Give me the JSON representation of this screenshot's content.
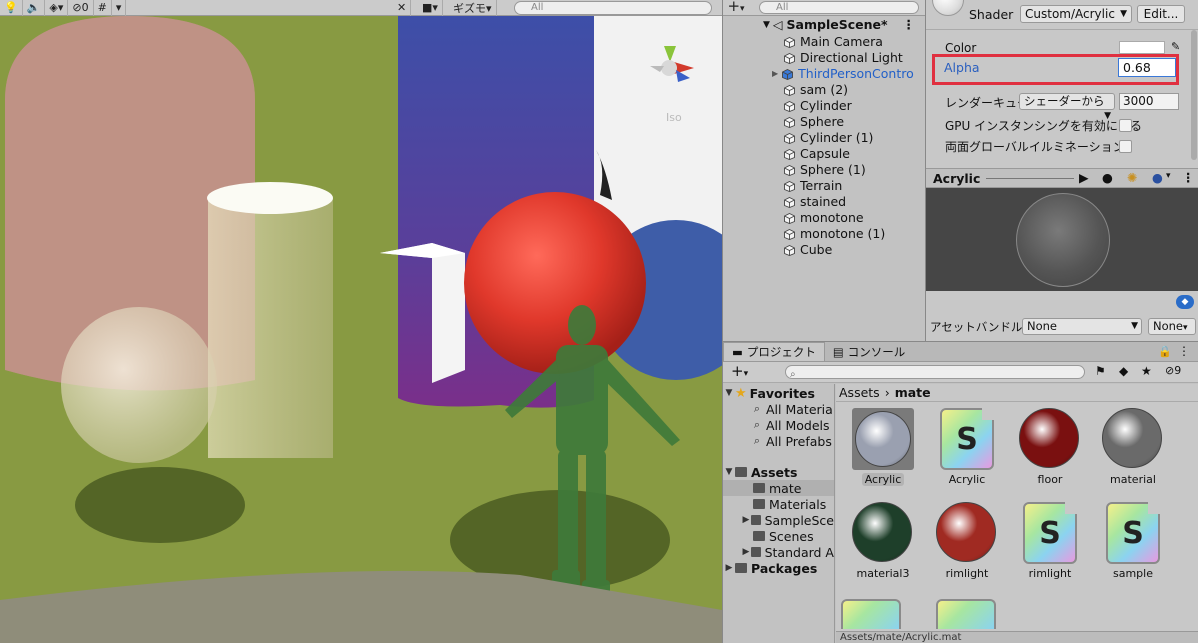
{
  "scene_view": {
    "toolbar": {
      "hidden_count": "0",
      "gizmo_label": "ギズモ",
      "search_placeholder": "All"
    },
    "iso_label": "Iso"
  },
  "hierarchy": {
    "search_placeholder": "All",
    "scene_name": "SampleScene*",
    "items": [
      {
        "label": "Main Camera"
      },
      {
        "label": "Directional Light"
      },
      {
        "label": "ThirdPersonContro"
      },
      {
        "label": "sam (2)"
      },
      {
        "label": "Cylinder"
      },
      {
        "label": "Sphere"
      },
      {
        "label": "Cylinder (1)"
      },
      {
        "label": "Capsule"
      },
      {
        "label": "Sphere (1)"
      },
      {
        "label": "Terrain"
      },
      {
        "label": "stained"
      },
      {
        "label": "monotone"
      },
      {
        "label": "monotone (1)"
      },
      {
        "label": "Cube"
      }
    ]
  },
  "inspector": {
    "shader_label": "Shader",
    "shader_value": "Custom/Acrylic",
    "edit_label": "Edit...",
    "color_label": "Color",
    "alpha_label": "Alpha",
    "alpha_value": "0.68",
    "render_queue_label": "レンダーキュー",
    "render_queue_mode": "シェーダーから",
    "render_queue_value": "3000",
    "gpu_instancing_label": "GPU インスタンシングを有効にする",
    "double_sided_gi_label": "両面グローバルイルミネーション",
    "preview_title": "Acrylic",
    "asset_bundle_label": "アセットバンドル",
    "asset_bundle_value": "None",
    "asset_variant_value": "None"
  },
  "project": {
    "tab_project": "プロジェクト",
    "tab_console": "コンソール",
    "hidden_count": "9",
    "tree": {
      "favorites_label": "Favorites",
      "favorites": [
        "All Materia",
        "All Models",
        "All Prefabs"
      ],
      "assets_label": "Assets",
      "assets": [
        "mate",
        "Materials",
        "SampleSce",
        "Scenes",
        "Standard A"
      ],
      "packages_label": "Packages"
    },
    "breadcrumb": {
      "root": "Assets",
      "current": "mate"
    },
    "items": [
      {
        "label": "Acrylic",
        "kind": "material",
        "color": "#9aa0b0"
      },
      {
        "label": "Acrylic",
        "kind": "shader"
      },
      {
        "label": "floor",
        "kind": "material",
        "color": "#7a1010"
      },
      {
        "label": "material",
        "kind": "material",
        "color": "#6a6a6a"
      },
      {
        "label": "material3",
        "kind": "material",
        "color": "#1e3f2a"
      },
      {
        "label": "rimlight",
        "kind": "material",
        "color": "#a02a22"
      },
      {
        "label": "rimlight",
        "kind": "shader"
      },
      {
        "label": "sample",
        "kind": "shader"
      }
    ],
    "status_path": "Assets/mate/Acrylic.mat"
  }
}
